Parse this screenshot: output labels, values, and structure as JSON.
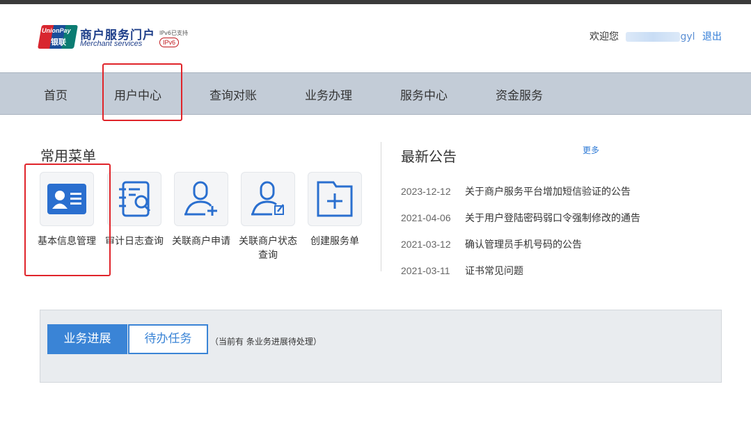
{
  "header": {
    "logo_badge_en": "UnionPay",
    "logo_badge_cn": "银联",
    "logo_title": "商户服务门户",
    "logo_subtitle": "Merchant services",
    "ipv6_note": "IPv6已支持",
    "ipv6_badge": "IPv6",
    "welcome": "欢迎您",
    "username_suffix": "gyl",
    "logout": "退出"
  },
  "nav": {
    "items": [
      {
        "label": "首页"
      },
      {
        "label": "用户中心"
      },
      {
        "label": "查询对账"
      },
      {
        "label": "业务办理"
      },
      {
        "label": "服务中心"
      },
      {
        "label": "资金服务"
      }
    ]
  },
  "common_menu": {
    "title": "常用菜单",
    "items": [
      {
        "label": "基本信息管理",
        "icon": "id-card-icon"
      },
      {
        "label": "审计日志查询",
        "icon": "log-search-icon"
      },
      {
        "label": "关联商户申请",
        "icon": "add-user-icon"
      },
      {
        "label": "关联商户状态查询",
        "icon": "user-status-icon"
      },
      {
        "label": "创建服务单",
        "icon": "create-folder-icon"
      }
    ]
  },
  "announcements": {
    "title": "最新公告",
    "more": "更多",
    "items": [
      {
        "date": "2023-12-12",
        "title": "关于商户服务平台增加短信验证的公告"
      },
      {
        "date": "2021-04-06",
        "title": "关于用户登陆密码弱口令强制修改的通告"
      },
      {
        "date": "2021-03-12",
        "title": "确认管理员手机号码的公告"
      },
      {
        "date": "2021-03-11",
        "title": "证书常见问题"
      }
    ]
  },
  "task_panel": {
    "tabs": [
      {
        "label": "业务进展",
        "active": true
      },
      {
        "label": "待办任务",
        "active": false
      }
    ],
    "note": "（当前有 条业务进展待处理）"
  },
  "colors": {
    "accent": "#3a84d6",
    "highlight": "#e0242a",
    "nav_bg": "#c3ccd7",
    "icon_blue": "#2a6fcf"
  }
}
